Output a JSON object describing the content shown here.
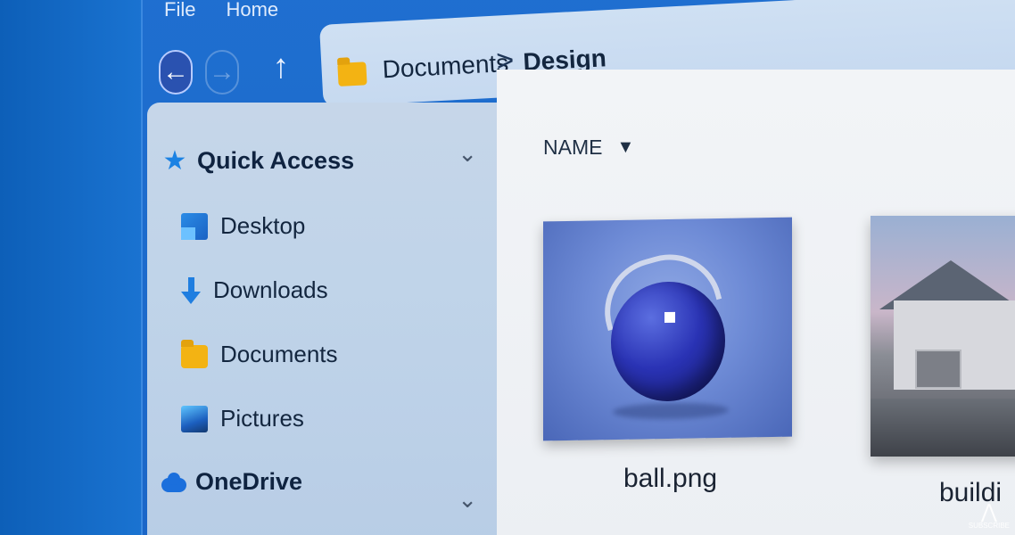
{
  "menubar": {
    "file": "File",
    "home": "Home"
  },
  "nav": {
    "back_icon": "arrow-left-icon",
    "forward_icon": "arrow-right-icon",
    "up_icon": "arrow-up-icon"
  },
  "address": {
    "segments": [
      "Documents",
      "Design"
    ],
    "separator": ">"
  },
  "sidebar": {
    "quick_access": {
      "label": "Quick Access",
      "chevron": "⌄"
    },
    "items": [
      {
        "label": "Desktop",
        "icon": "desktop-icon"
      },
      {
        "label": "Downloads",
        "icon": "download-icon"
      },
      {
        "label": "Documents",
        "icon": "folder-icon"
      },
      {
        "label": "Pictures",
        "icon": "pictures-icon"
      }
    ],
    "onedrive": {
      "label": "OneDrive",
      "chevron": "⌄"
    }
  },
  "content": {
    "sort_header": "NAME",
    "sort_arrow": "▼",
    "files": [
      {
        "name": "ball.png"
      },
      {
        "name": "buildi"
      }
    ]
  },
  "watermark": {
    "text": "SUBSCRIBE"
  },
  "colors": {
    "accent": "#1b6fdc",
    "window_blue": "#1f6fd0",
    "folder_yellow": "#f3b313"
  }
}
